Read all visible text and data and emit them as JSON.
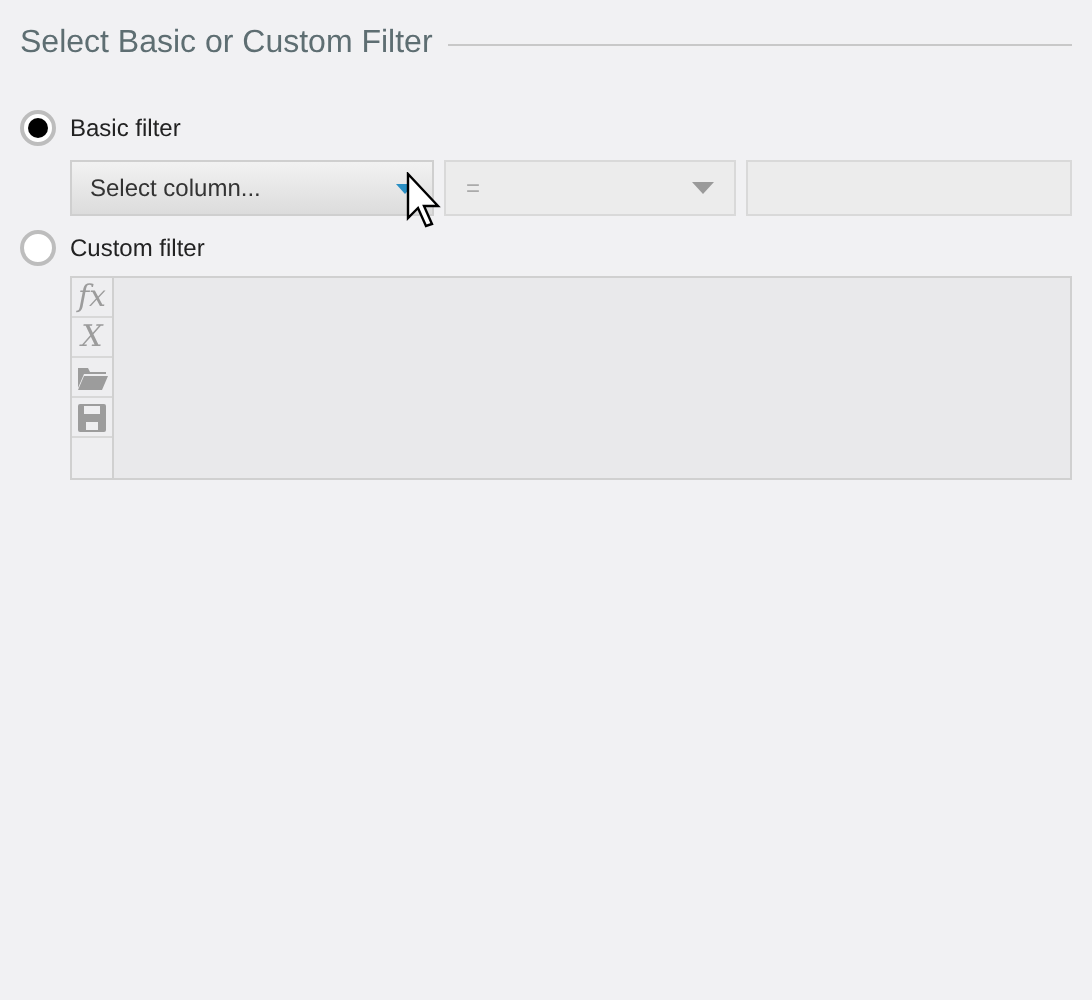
{
  "title": "Select Basic or Custom Filter",
  "options": [
    {
      "label": "Basic filter",
      "selected": true
    },
    {
      "label": "Custom filter",
      "selected": false
    }
  ],
  "basic": {
    "column": {
      "placeholder": "Select column..."
    },
    "operator": {
      "value": "=",
      "disabled": true
    },
    "value": {
      "disabled": true
    }
  },
  "custom": {
    "toolbar": [
      {
        "kind": "text",
        "text": "fx"
      },
      {
        "kind": "text",
        "text": "X"
      },
      {
        "kind": "folder"
      },
      {
        "kind": "save"
      }
    ]
  }
}
